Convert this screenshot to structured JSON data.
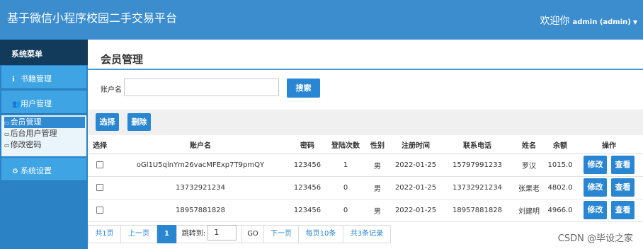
{
  "app": {
    "title": "基于微信小程序校园二手交易平台",
    "welcome": "欢迎你",
    "user": "admin (admin)"
  },
  "sidebar": {
    "header": "系统菜单",
    "items": [
      {
        "icon": "info-icon",
        "label": "书籍管理"
      },
      {
        "icon": "user-add-icon",
        "label": "用户管理"
      },
      {
        "icon": "gear-icon",
        "label": "系统设置"
      }
    ],
    "subitems": [
      "会员管理",
      "后台用户管理",
      "修改密码"
    ]
  },
  "page": {
    "title": "会员管理"
  },
  "search": {
    "label": "账户名",
    "value": "",
    "button": "搜索"
  },
  "toolbar": {
    "select": "选择",
    "delete": "删除"
  },
  "table": {
    "headers": [
      "选择",
      "账户名",
      "密码",
      "登陆次数",
      "性别",
      "注册时间",
      "联系电话",
      "姓名",
      "余额",
      "操作"
    ],
    "rows": [
      [
        "oGl1U5qlnYm26vacMFExp7T9pmQY",
        "123456",
        "1",
        "男",
        "2022-01-25",
        "15797991233",
        "罗汉",
        "1015.0"
      ],
      [
        "13732921234",
        "123456",
        "0",
        "男",
        "2022-01-25",
        "13732921234",
        "张果老",
        "4802.0"
      ],
      [
        "18957881828",
        "123456",
        "0",
        "男",
        "2022-01-25",
        "18957881828",
        "刘建明",
        "4966.0"
      ]
    ],
    "edit": "修改",
    "view": "查看"
  },
  "pager": {
    "total_pages": "共1页",
    "prev": "上一页",
    "current": "1",
    "jump_label": "跳转到:",
    "jump_value": "1",
    "go": "GO",
    "next": "下一页",
    "per_page": "每页10条",
    "total_records": "共3条记录"
  },
  "watermark": "CSDN @毕设之家",
  "colors": {
    "header": "#3c8dce",
    "sidebar": "#2b83c6",
    "sidebar_head": "#123a5a",
    "accent": "#2986d3"
  }
}
